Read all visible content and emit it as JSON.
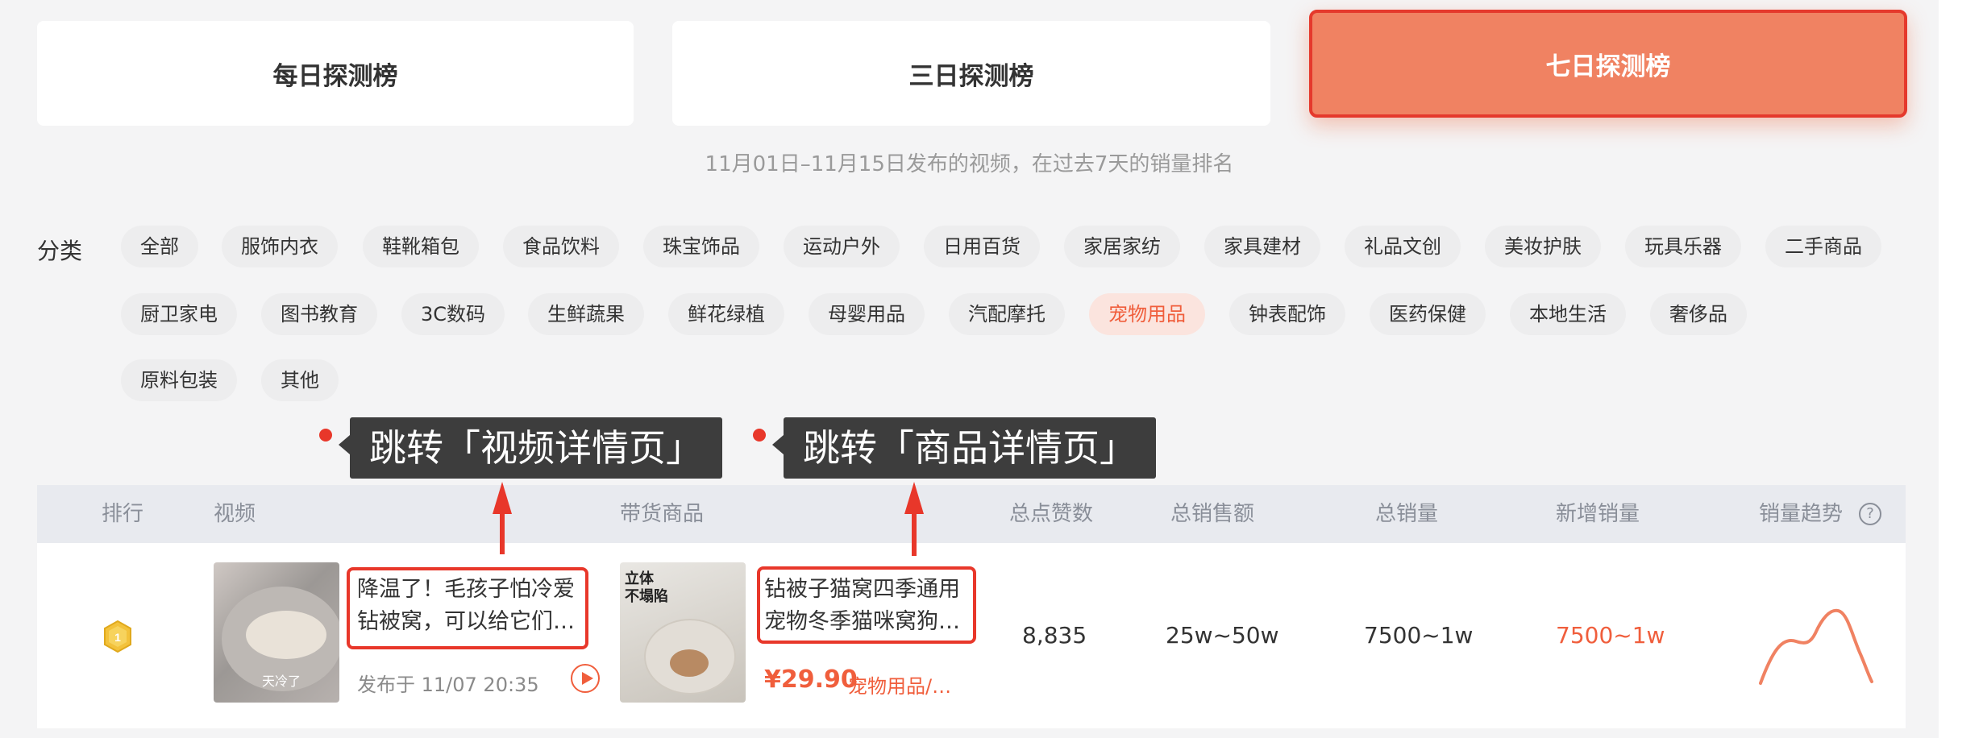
{
  "tabs": [
    {
      "label": "每日探测榜"
    },
    {
      "label": "三日探测榜"
    },
    {
      "label": "七日探测榜",
      "active": true
    }
  ],
  "subtitle": "11月01日–11月15日发布的视频，在过去7天的销量排名",
  "category_label": "分类",
  "categories": [
    "全部",
    "服饰内衣",
    "鞋靴箱包",
    "食品饮料",
    "珠宝饰品",
    "运动户外",
    "日用百货",
    "家居家纺",
    "家具建材",
    "礼品文创",
    "美妆护肤",
    "玩具乐器",
    "二手商品",
    "厨卫家电",
    "图书教育",
    "3C数码",
    "生鲜蔬果",
    "鲜花绿植",
    "母婴用品",
    "汽配摩托",
    "宠物用品",
    "钟表配饰",
    "医药保健",
    "本地生活",
    "奢侈品",
    "原料包装",
    "其他"
  ],
  "active_category": "宠物用品",
  "annotations": {
    "video": "跳转「视频详情页」",
    "product": "跳转「商品详情页」"
  },
  "table": {
    "headers": {
      "rank": "排行",
      "video": "视频",
      "product": "带货商品",
      "likes": "总点赞数",
      "sales_amount": "总销售额",
      "sales_volume": "总销量",
      "new_sales": "新增销量",
      "trend": "销量趋势"
    },
    "rows": [
      {
        "rank_badge": "1",
        "video_thumb_text": "天冷了",
        "video_title_line1": "降温了！毛孩子怕冷爱",
        "video_title_line2": "钻被窝，可以给它们…",
        "published": "发布于 11/07 20:35",
        "product_thumb_text": "立体 不塌陷",
        "product_title_line1": "钻被子猫窝四季通用",
        "product_title_line2": "宠物冬季猫咪窝狗…",
        "price": "¥29.90",
        "product_category": "宠物用品/…",
        "likes": "8,835",
        "sales_amount": "25w~50w",
        "sales_volume": "7500~1w",
        "new_sales": "7500~1w"
      }
    ]
  },
  "colors": {
    "accent": "#f08262",
    "highlight_red": "#e8372a",
    "orange_text": "#f05e3c"
  }
}
